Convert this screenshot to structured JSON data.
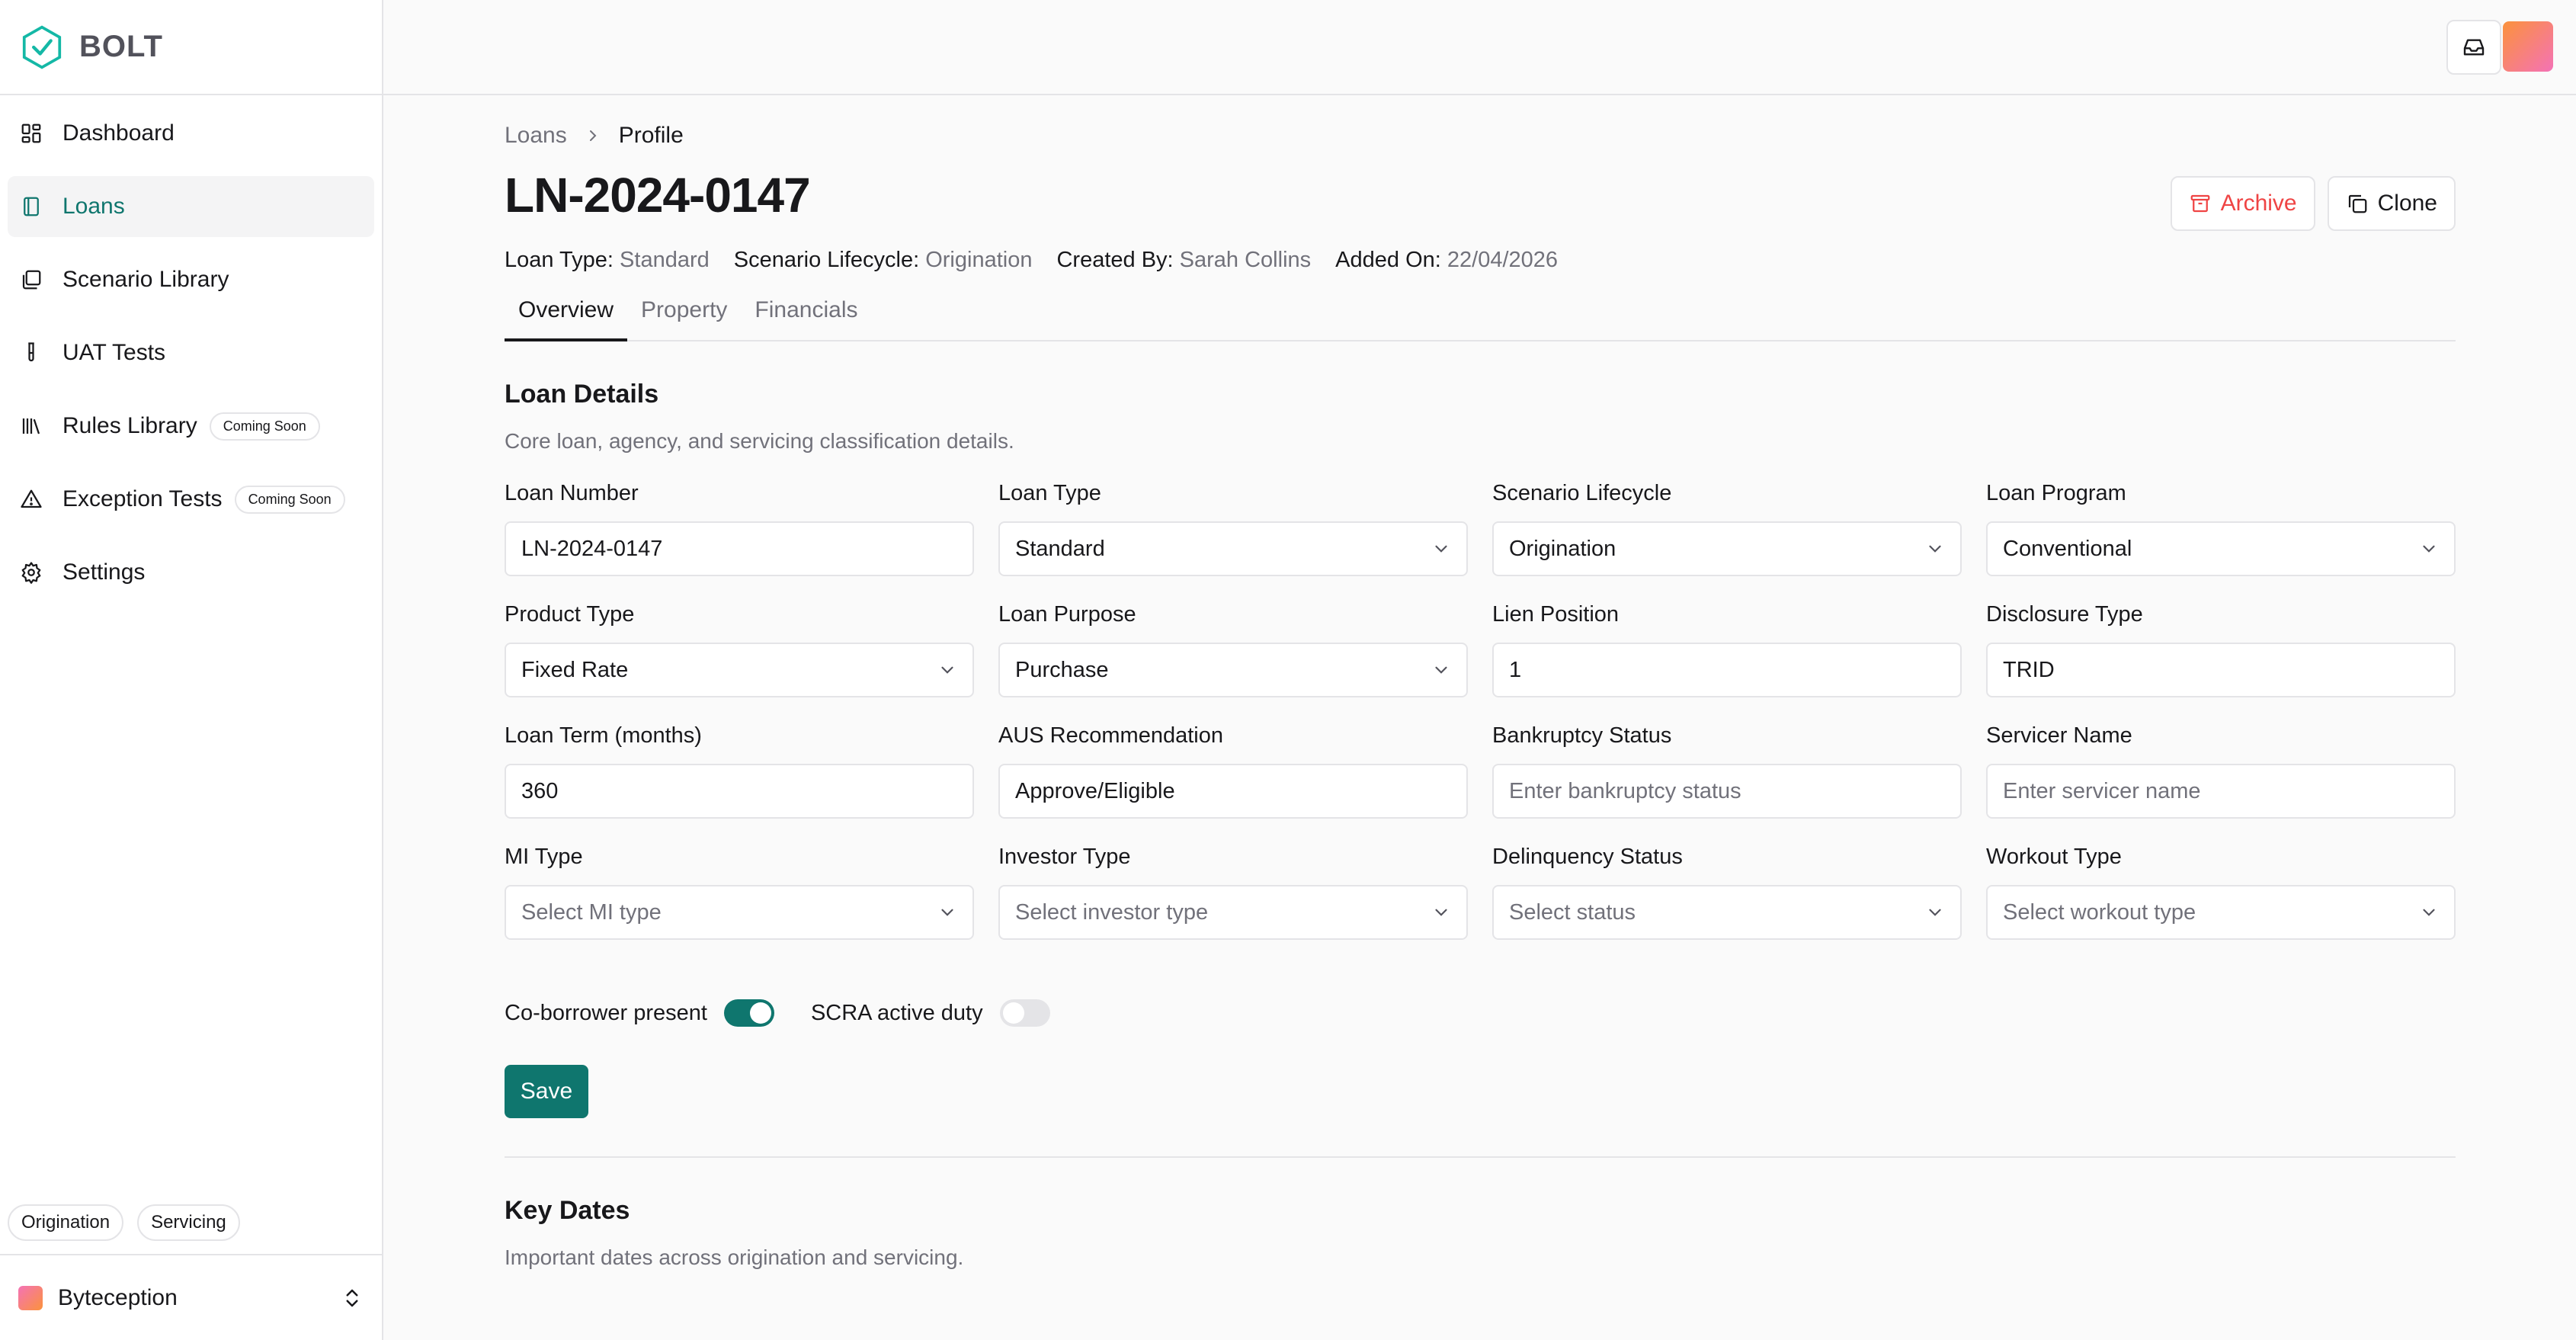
{
  "app": {
    "name": "BOLT"
  },
  "sidebar": {
    "items": [
      {
        "label": "Dashboard",
        "icon": "dashboard-icon"
      },
      {
        "label": "Loans",
        "icon": "book-icon",
        "active": true
      },
      {
        "label": "Scenario Library",
        "icon": "library-icon"
      },
      {
        "label": "UAT Tests",
        "icon": "test-tube-icon"
      },
      {
        "label": "Rules Library",
        "icon": "books-icon",
        "badge": "Coming Soon"
      },
      {
        "label": "Exception Tests",
        "icon": "warning-icon",
        "badge": "Coming Soon"
      },
      {
        "label": "Settings",
        "icon": "gear-icon"
      }
    ],
    "modes": [
      "Origination",
      "Servicing"
    ],
    "org": "Byteception"
  },
  "breadcrumb": {
    "parent": "Loans",
    "current": "Profile"
  },
  "header": {
    "title": "LN-2024-0147",
    "archive_label": "Archive",
    "clone_label": "Clone"
  },
  "meta": [
    {
      "label": "Loan Type:",
      "value": "Standard"
    },
    {
      "label": "Scenario Lifecycle:",
      "value": "Origination"
    },
    {
      "label": "Created By:",
      "value": "Sarah Collins"
    },
    {
      "label": "Added On:",
      "value": "22/04/2026"
    }
  ],
  "tabs": [
    "Overview",
    "Property",
    "Financials"
  ],
  "loan_details": {
    "title": "Loan Details",
    "description": "Core loan, agency, and servicing classification details.",
    "fields": [
      {
        "label": "Loan Number",
        "value": "LN-2024-0147",
        "kind": "text"
      },
      {
        "label": "Loan Type",
        "value": "Standard",
        "kind": "select"
      },
      {
        "label": "Scenario Lifecycle",
        "value": "Origination",
        "kind": "select"
      },
      {
        "label": "Loan Program",
        "value": "Conventional",
        "kind": "select"
      },
      {
        "label": "Product Type",
        "value": "Fixed Rate",
        "kind": "select"
      },
      {
        "label": "Loan Purpose",
        "value": "Purchase",
        "kind": "select"
      },
      {
        "label": "Lien Position",
        "value": "1",
        "kind": "text"
      },
      {
        "label": "Disclosure Type",
        "value": "TRID",
        "kind": "text"
      },
      {
        "label": "Loan Term (months)",
        "value": "360",
        "kind": "text"
      },
      {
        "label": "AUS Recommendation",
        "value": "Approve/Eligible",
        "kind": "text"
      },
      {
        "label": "Bankruptcy Status",
        "placeholder": "Enter bankruptcy status",
        "kind": "text"
      },
      {
        "label": "Servicer Name",
        "placeholder": "Enter servicer name",
        "kind": "text"
      },
      {
        "label": "MI Type",
        "placeholder": "Select MI type",
        "kind": "select"
      },
      {
        "label": "Investor Type",
        "placeholder": "Select investor type",
        "kind": "select"
      },
      {
        "label": "Delinquency Status",
        "placeholder": "Select status",
        "kind": "select"
      },
      {
        "label": "Workout Type",
        "placeholder": "Select workout type",
        "kind": "select"
      }
    ],
    "toggles": [
      {
        "label": "Co-borrower present",
        "on": true
      },
      {
        "label": "SCRA active duty",
        "on": false
      }
    ],
    "save_label": "Save"
  },
  "key_dates": {
    "title": "Key Dates",
    "description": "Important dates across origination and servicing."
  },
  "colors": {
    "accent": "#0f766e",
    "danger": "#ef4444"
  }
}
